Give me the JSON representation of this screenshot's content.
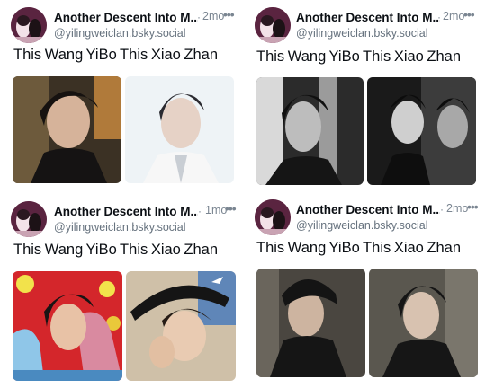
{
  "posts": [
    {
      "display_name": "Another Descent Into M...",
      "separator": "·",
      "time": "2mo",
      "more": "•••",
      "handle": "@yilingweiclan.bsky.social",
      "caption": "This Wang YiBo   This Xiao Zhan",
      "photos": [
        "photo-yibo",
        "photo-xiaozhan"
      ]
    },
    {
      "display_name": "Another Descent Into M...",
      "separator": "·",
      "time": "2mo",
      "more": "•••",
      "handle": "@yilingweiclan.bsky.social",
      "caption": "This Wang YiBo   This Xiao Zhan",
      "photos": [
        "photo-yibo-bw",
        "photo-xiaozhan-bw"
      ]
    },
    {
      "display_name": "Another Descent Into M...",
      "separator": "·",
      "time": "1mo",
      "more": "•••",
      "handle": "@yilingweiclan.bsky.social",
      "caption": "This Wang YiBo   This Xiao Zhan",
      "photos": [
        "photo-yibo-color",
        "photo-xiaozhan-cap"
      ]
    },
    {
      "display_name": "Another Descent Into M...",
      "separator": "·",
      "time": "2mo",
      "more": "•••",
      "handle": "@yilingweiclan.bsky.social",
      "caption": "This Wang YiBo   This Xiao Zhan",
      "photos": [
        "photo-yibo-dark",
        "photo-xiaozhan-dark"
      ]
    }
  ]
}
